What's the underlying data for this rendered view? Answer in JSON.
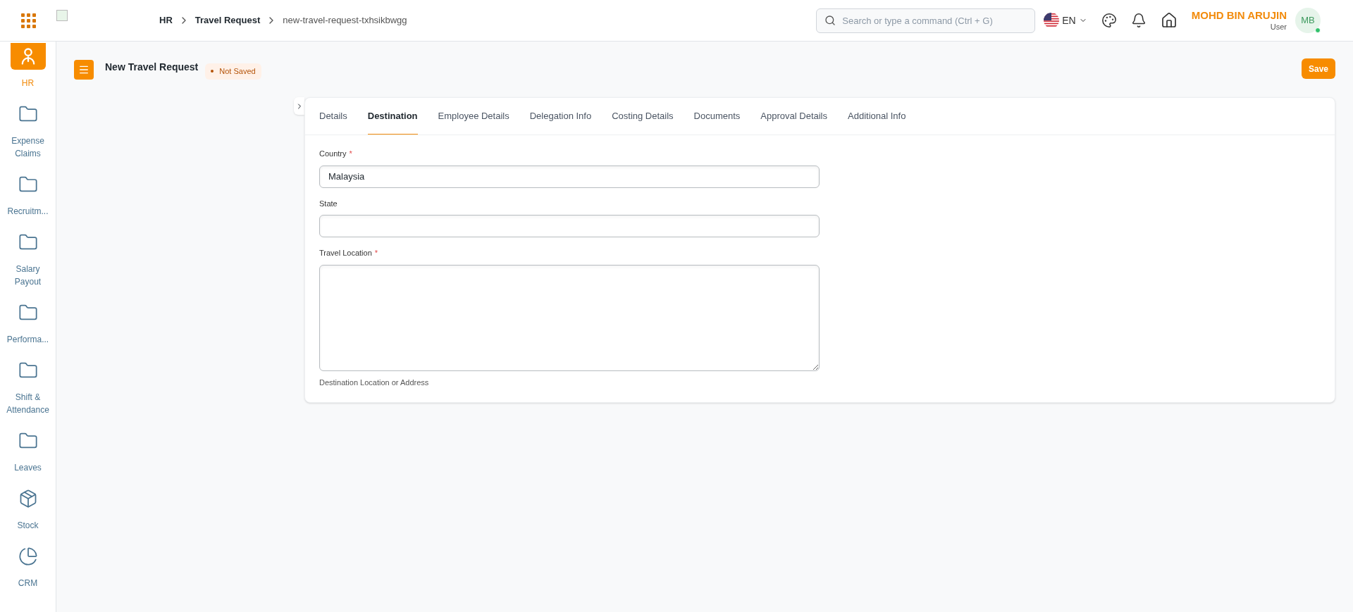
{
  "topbar": {
    "breadcrumbs": [
      {
        "label": "HR",
        "current": false
      },
      {
        "label": "Travel Request",
        "current": false
      },
      {
        "label": "new-travel-request-txhsikbwgg",
        "current": true
      }
    ],
    "search": {
      "placeholder": "Search or type a command (Ctrl + G)"
    },
    "language": "EN",
    "user": {
      "name": "MOHD BIN ARUJIN",
      "role": "User",
      "initials": "MB",
      "online": true
    }
  },
  "sidebar": {
    "items": [
      {
        "label": "HR",
        "kind": "hr",
        "selected": true
      },
      {
        "label": "Expense Claims",
        "kind": "folder",
        "selected": false
      },
      {
        "label": "Recruitm...",
        "kind": "folder",
        "selected": false
      },
      {
        "label": "Salary Payout",
        "kind": "folder",
        "selected": false
      },
      {
        "label": "Performa...",
        "kind": "folder",
        "selected": false
      },
      {
        "label": "Shift & Attendance",
        "kind": "folder",
        "selected": false
      },
      {
        "label": "Leaves",
        "kind": "folder",
        "selected": false
      },
      {
        "label": "Stock",
        "kind": "box",
        "selected": false
      },
      {
        "label": "CRM",
        "kind": "pie",
        "selected": false
      }
    ]
  },
  "page": {
    "title": "New Travel Request",
    "status": "Not Saved",
    "save_button": "Save"
  },
  "tabs": [
    {
      "label": "Details",
      "selected": false
    },
    {
      "label": "Destination",
      "selected": true
    },
    {
      "label": "Employee Details",
      "selected": false
    },
    {
      "label": "Delegation Info",
      "selected": false
    },
    {
      "label": "Costing Details",
      "selected": false
    },
    {
      "label": "Documents",
      "selected": false
    },
    {
      "label": "Approval Details",
      "selected": false
    },
    {
      "label": "Additional Info",
      "selected": false
    }
  ],
  "fields": [
    {
      "label": "Country",
      "kind": "input",
      "required_mark": "*",
      "value": "Malaysia"
    },
    {
      "label": "State",
      "kind": "input"
    },
    {
      "label": "Travel Location",
      "kind": "textarea",
      "required_mark": "*",
      "description": "Destination Location or Address"
    }
  ]
}
